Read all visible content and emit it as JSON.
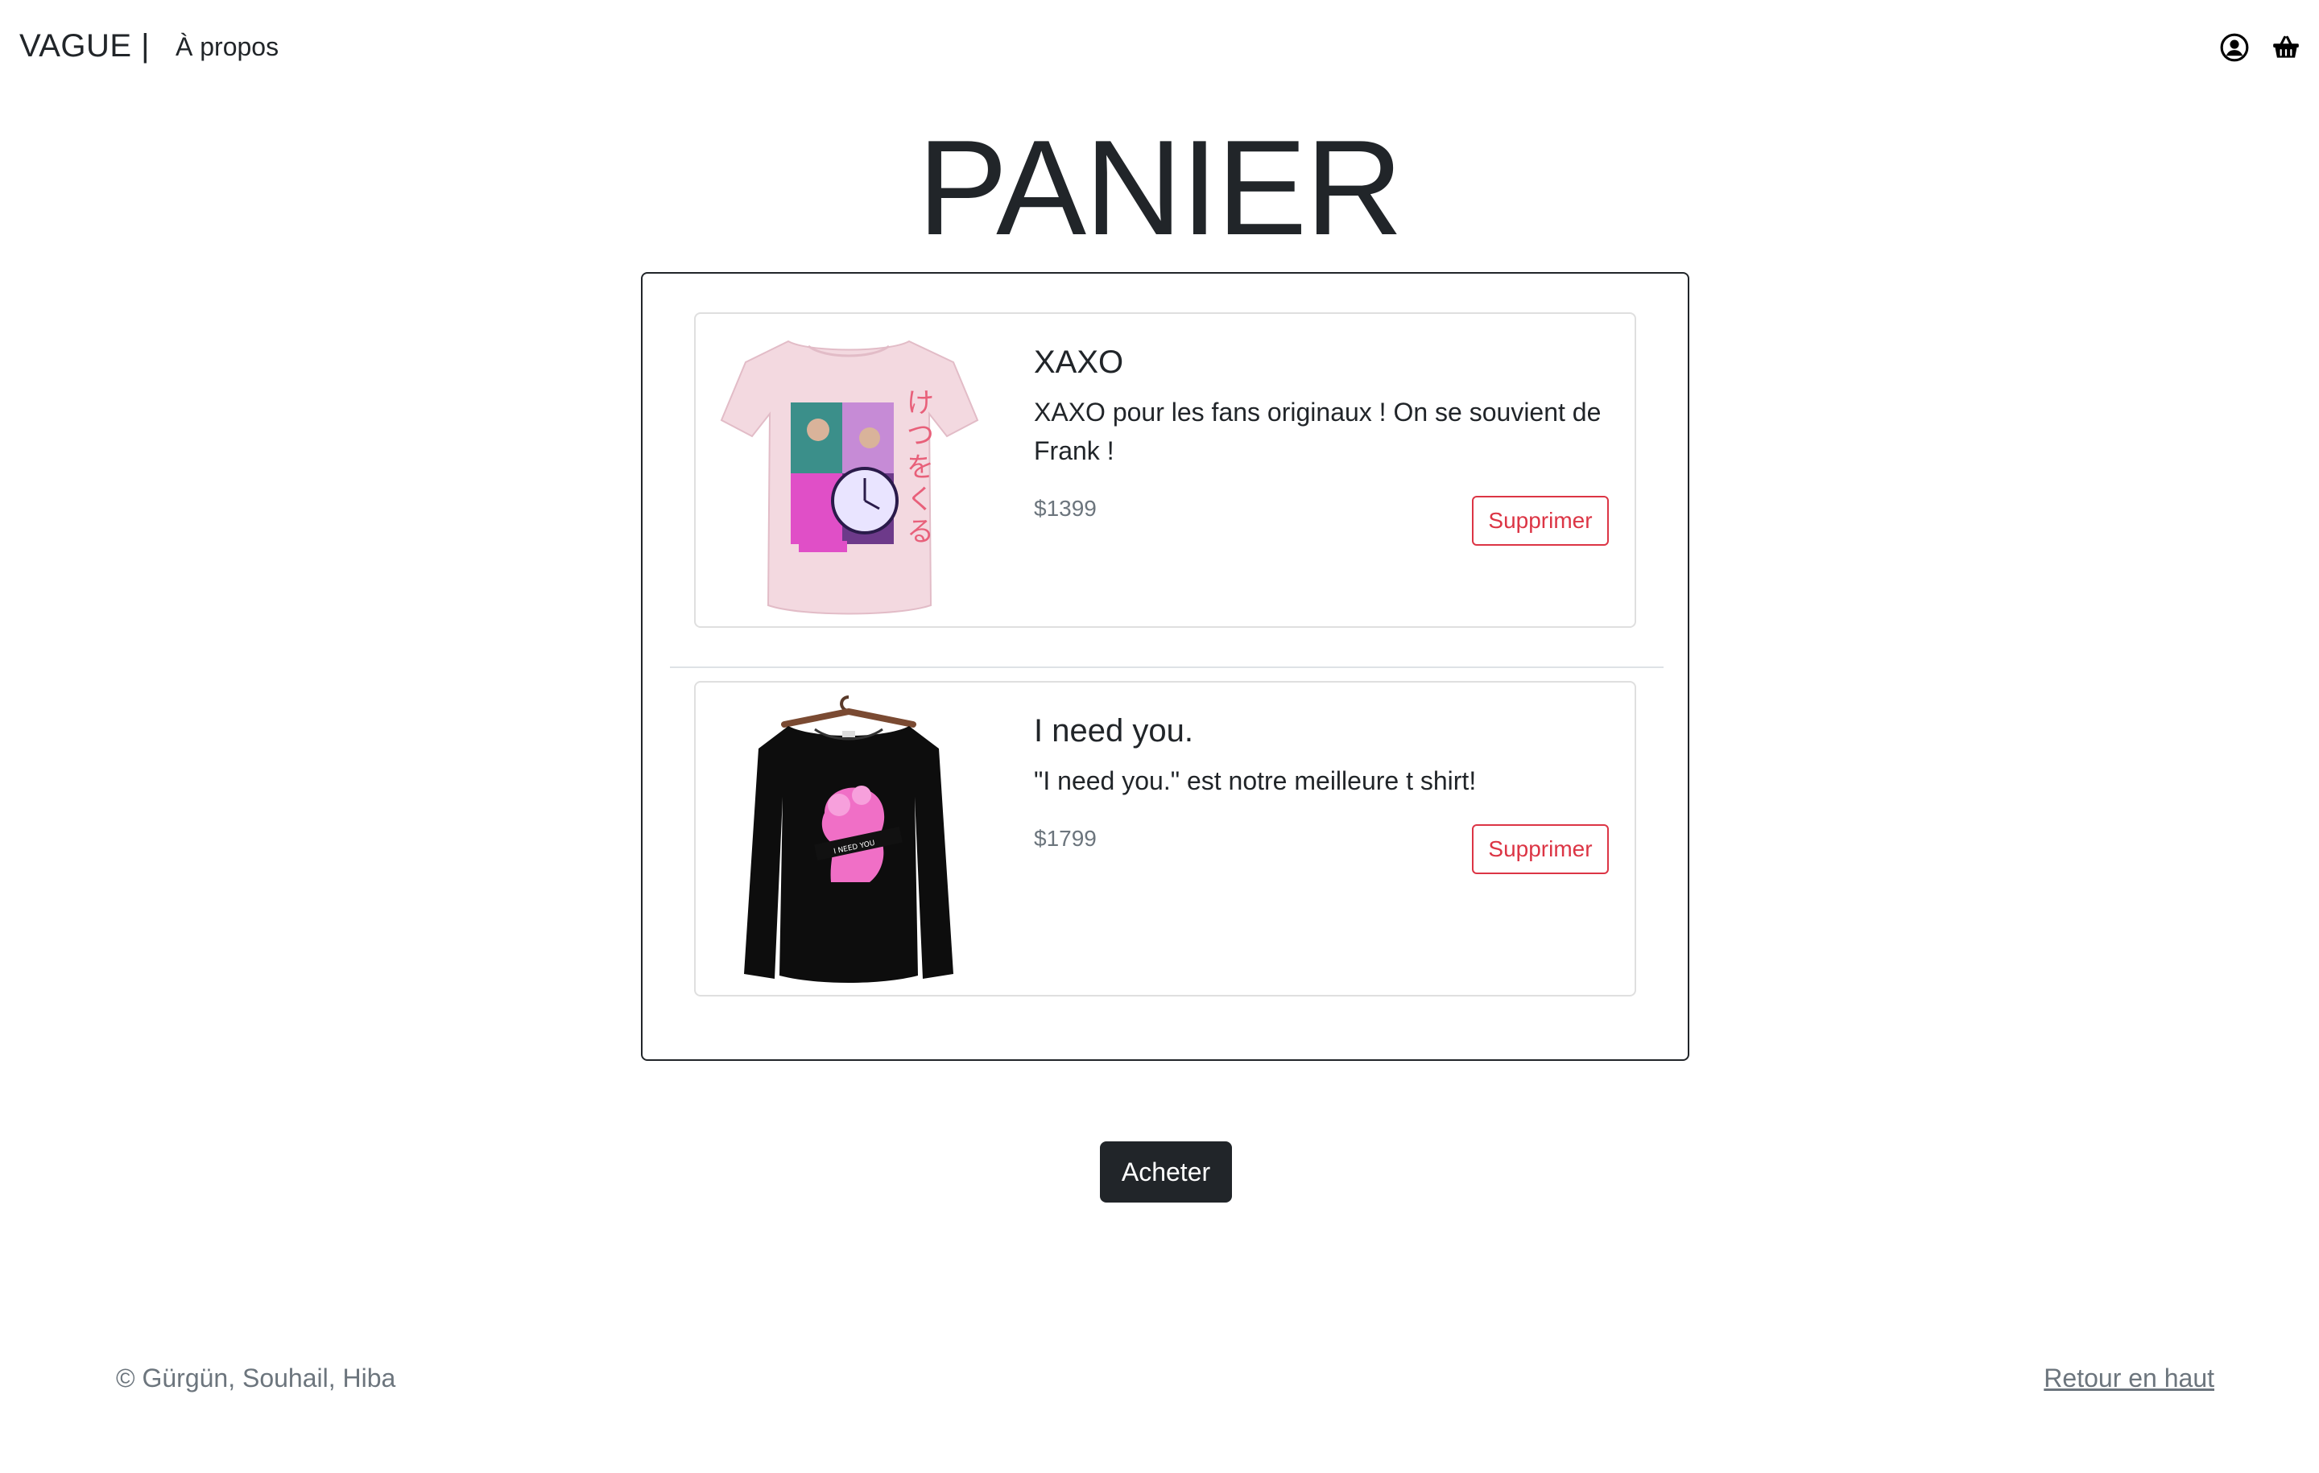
{
  "navbar": {
    "brand": "VAGUE |",
    "about_link": "À propos",
    "icons": [
      "user-circle-icon",
      "basket-icon"
    ]
  },
  "page": {
    "title": "PANIER"
  },
  "cart": {
    "items": [
      {
        "name": "XAXO",
        "description": "XAXO pour les fans originaux ! On se souvient de Frank !",
        "price": "$1399",
        "remove_label": "Supprimer",
        "image": "pink-tshirt-image"
      },
      {
        "name": "I need you.",
        "description": "\"I need you.\" est notre meilleure t shirt!",
        "price": "$1799",
        "remove_label": "Supprimer",
        "image": "black-longsleeve-image",
        "print_text": "I NEED YOU"
      }
    ],
    "buy_label": "Acheter"
  },
  "footer": {
    "copyright": "© Gürgün, Souhail, Hiba",
    "back_to_top": "Retour en haut"
  },
  "colors": {
    "text": "#212529",
    "muted": "#6c757d",
    "danger": "#dc3545",
    "dark_button": "#212529",
    "card_border": "#dfdfdf"
  }
}
